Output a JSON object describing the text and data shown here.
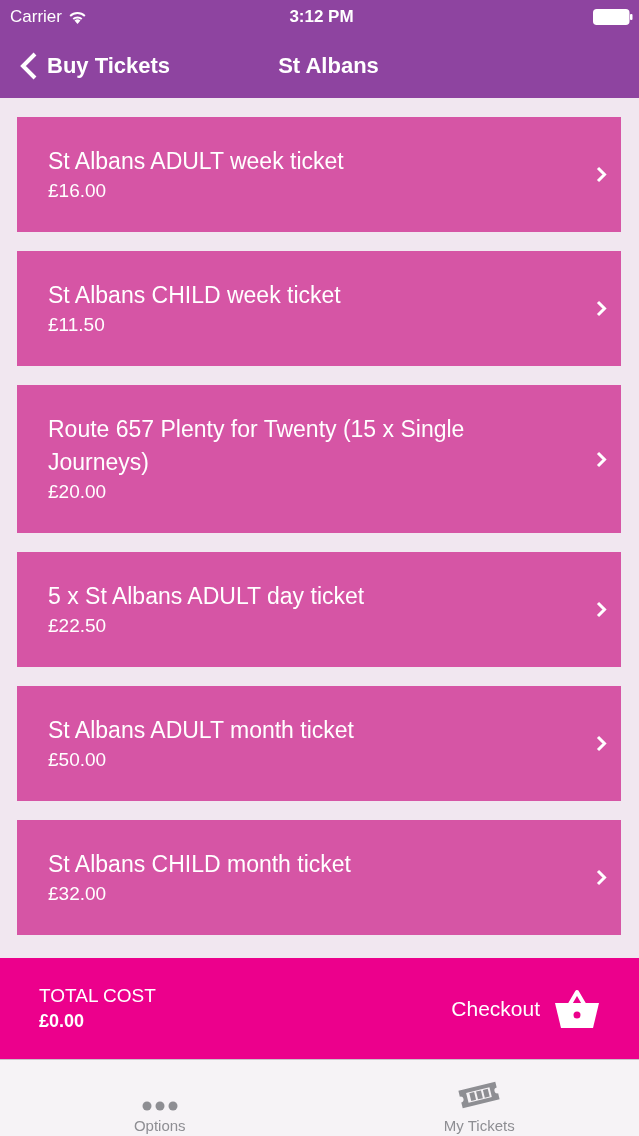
{
  "status_bar": {
    "carrier": "Carrier",
    "time": "3:12 PM"
  },
  "nav_bar": {
    "back": "Buy Tickets",
    "title": "St Albans"
  },
  "tickets": [
    {
      "name": "St Albans ADULT week ticket",
      "price": "£16.00"
    },
    {
      "name": "St Albans CHILD week ticket",
      "price": "£11.50"
    },
    {
      "name": "Route 657 Plenty for Twenty (15 x Single Journeys)",
      "price": "£20.00"
    },
    {
      "name": "5 x St Albans ADULT day ticket",
      "price": "£22.50"
    },
    {
      "name": "St Albans ADULT month ticket",
      "price": "£50.00"
    },
    {
      "name": "St Albans CHILD month ticket",
      "price": "£32.00"
    }
  ],
  "checkout_bar": {
    "total_label": "TOTAL COST",
    "total": "£0.00",
    "checkout": "Checkout"
  },
  "tab_bar": [
    {
      "kind": "options",
      "label": "Options",
      "selected": false
    },
    {
      "kind": "tickets",
      "label": "My Tickets",
      "selected": false
    }
  ]
}
